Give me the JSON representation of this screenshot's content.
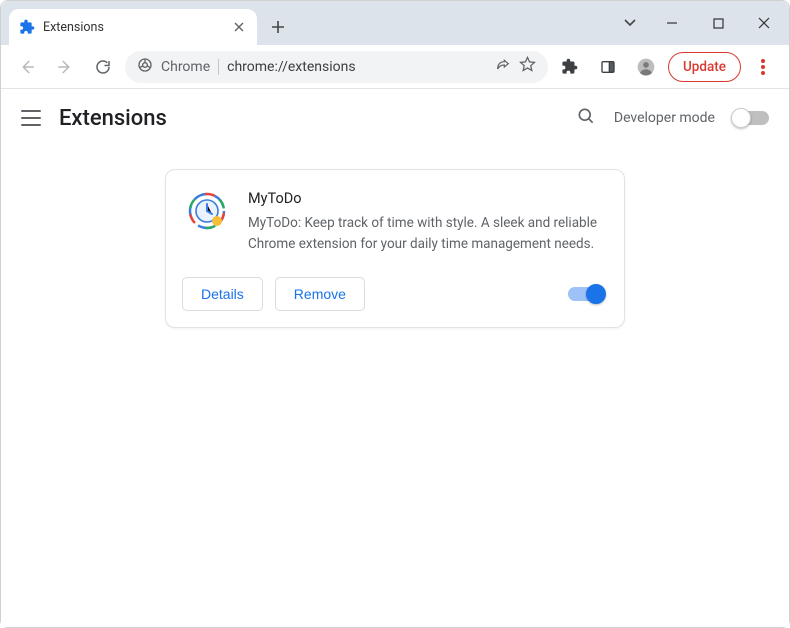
{
  "tab": {
    "title": "Extensions"
  },
  "omnibox": {
    "label": "Chrome",
    "url": "chrome://extensions"
  },
  "toolbar": {
    "update_label": "Update"
  },
  "page": {
    "title": "Extensions",
    "developer_mode_label": "Developer mode",
    "developer_mode_on": false
  },
  "extension": {
    "name": "MyToDo",
    "description": "MyToDo: Keep track of time with style. A sleek and reliable Chrome extension for your daily time management needs.",
    "details_label": "Details",
    "remove_label": "Remove",
    "enabled": true
  }
}
